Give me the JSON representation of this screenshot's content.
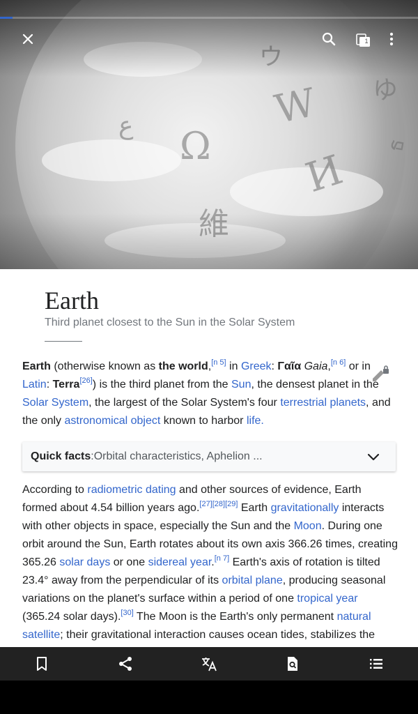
{
  "hero": {
    "background_color": "#b5b5b5",
    "glyphs": [
      "Ω",
      "W",
      "И",
      "維",
      "ウ",
      "ゆ",
      "ع",
      "ธ"
    ]
  },
  "progress": {
    "fraction": 0.03,
    "color": "#3366cc"
  },
  "toolbar": {
    "close_icon": "close-icon",
    "search_icon": "search-icon",
    "tabs_icon": "tabs-icon",
    "tab_count": "1",
    "more_icon": "more-vert-icon"
  },
  "article": {
    "title": "Earth",
    "description": "Third planet closest to the Sun in the Solar System",
    "link_color": "#3366cc",
    "lead": {
      "s1": "Earth",
      "s2": " (otherwise known as ",
      "s3": "the world",
      "s4": ",",
      "s5": "[n 5]",
      "s6": " in ",
      "s7": "Greek",
      "s8": ": ",
      "s9": "Γαῖα",
      "s10": " ",
      "s11": "Gaia",
      "s12": ",",
      "s13": "[n 6]",
      "s14": " or in ",
      "s15": "Latin",
      "s16": ": ",
      "s17": "Terra",
      "s18": "[26]",
      "s19": ") is the third planet from the ",
      "s20": "Sun",
      "s21": ", the densest planet in the ",
      "s22": "Solar System",
      "s23": ", the largest of the Solar System's four ",
      "s24": "terrestrial planets",
      "s25": ", and the only ",
      "s26": "astronomical object",
      "s27": " known to harbor ",
      "s28": "life",
      "s29": "."
    },
    "quick_facts": {
      "label": "Quick facts",
      "separator": ": ",
      "summary": "Orbital characteristics, Aphelion ..."
    },
    "para2": {
      "s1": "According to ",
      "s2": "radiometric dating",
      "s3": " and other sources of evidence, Earth formed about 4.54 billion years ago.",
      "s4": "[27][28][29]",
      "s5": " Earth ",
      "s6": "gravitationally",
      "s7": " interacts with other objects in space, especially the Sun and the ",
      "s8": "Moon",
      "s9": ". During one orbit around the Sun, Earth rotates about its own axis 366.26 times, creating 365.26 ",
      "s10": "solar days",
      "s11": " or one ",
      "s12": "sidereal year",
      "s13": ".",
      "s14": "[n 7]",
      "s15": " Earth's axis of rotation is tilted 23.4° away from the perpendicular of its ",
      "s16": "orbital plane",
      "s17": ", producing seasonal variations on the planet's surface within a period of one ",
      "s18": "tropical year",
      "s19": " (365.24 solar days).",
      "s20": "[30]",
      "s21": " The Moon is the Earth's only permanent ",
      "s22": "natural satellite",
      "s23": "; their gravitational interaction causes ocean tides, stabilizes the"
    }
  },
  "bottom_bar": {
    "items": [
      "bookmark-icon",
      "share-icon",
      "translate-icon",
      "find-in-page-icon",
      "table-of-contents-icon"
    ]
  }
}
